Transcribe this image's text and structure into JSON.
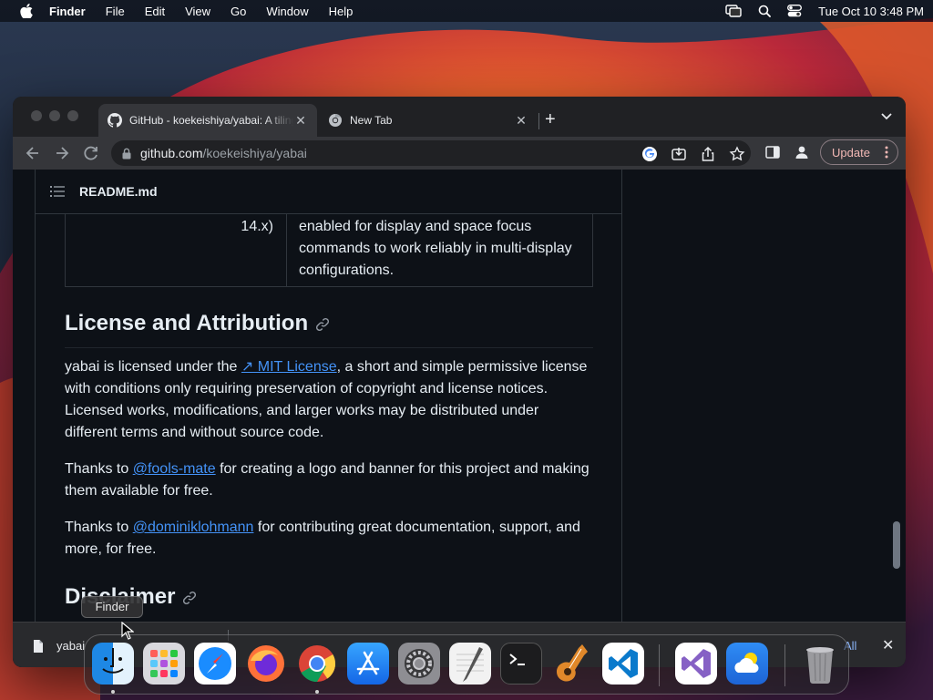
{
  "menubar": {
    "app": "Finder",
    "items": [
      "File",
      "Edit",
      "View",
      "Go",
      "Window",
      "Help"
    ],
    "clock": "Tue Oct 10  3:48 PM"
  },
  "browser": {
    "tabs": [
      {
        "title": "GitHub - koekeishiya/yabai: A tiling window manager",
        "icon": "github-icon"
      },
      {
        "title": "New Tab",
        "icon": "chrome-icon"
      }
    ],
    "url_host": "github.com",
    "url_path": "/koekeishiya/yabai",
    "update_label": "Update"
  },
  "readme": {
    "filename": "README.md",
    "table_row": {
      "col1": "14.x)",
      "col2": "enabled for display and space focus commands to work reliably in multi-display configurations."
    },
    "license_heading": "License and Attribution",
    "license_para": {
      "before": "yabai is licensed under the ",
      "link": "↗ MIT License",
      "after": ", a short and simple permissive license with conditions only requiring preservation of copyright and license notices. Licensed works, modifications, and larger works may be distributed under different terms and without source code."
    },
    "thanks1": {
      "before": "Thanks to ",
      "link": "@fools-mate",
      "after": " for creating a logo and banner for this project and making them available for free."
    },
    "thanks2": {
      "before": "Thanks to ",
      "link": "@dominiklohmann",
      "after": " for contributing great documentation, support, and more, for free."
    },
    "disclaimer_heading": "Disclaimer"
  },
  "downloads": {
    "file_name": "yabai",
    "show_all": "All"
  },
  "dock": {
    "tooltip": "Finder",
    "apps": [
      "Finder",
      "Launchpad",
      "Safari",
      "Firefox",
      "Google Chrome",
      "App Store",
      "System Settings",
      "TextEdit",
      "Terminal",
      "GarageBand",
      "Visual Studio Code",
      "Visual Studio",
      "Weather",
      "Trash"
    ]
  },
  "colors": {
    "link": "#4493f8",
    "page_bg": "#0d1117",
    "update_text": "#f2b8b5"
  }
}
